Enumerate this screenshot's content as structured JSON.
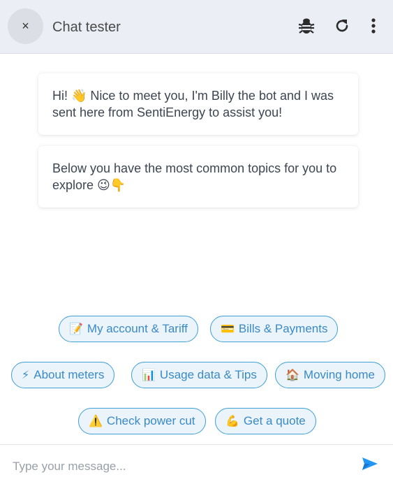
{
  "header": {
    "close_symbol": "×",
    "title": "Chat tester",
    "icons": [
      "close-icon",
      "bug-icon",
      "refresh-icon",
      "kebab-menu-icon"
    ]
  },
  "messages": [
    {
      "emoji": "👋",
      "text_before": "Hi! ",
      "text_after": " Nice to meet you, I'm Billy the bot and I was sent here from SentiEnergy to assist you!"
    },
    {
      "text": "Below you have the most common topics for you to explore ",
      "emoji": "😉👇"
    }
  ],
  "quick_replies": [
    {
      "emoji": "📝",
      "label": "My account & Tariff"
    },
    {
      "emoji": "💳",
      "label": "Bills & Payments"
    },
    {
      "emoji": "⚡",
      "label": "About meters"
    },
    {
      "emoji": "📊",
      "label": "Usage data & Tips"
    },
    {
      "emoji": "🏠",
      "label": "Moving home"
    },
    {
      "emoji": "⚠️",
      "label": "Check power cut"
    },
    {
      "emoji": "💪",
      "label": "Get a quote"
    }
  ],
  "composer": {
    "placeholder": "Type your message...",
    "send_icon": "send-icon"
  },
  "colors": {
    "header_bg": "#eceef5",
    "chip_border": "#3ea0d6",
    "chip_bg": "#ebf3fb",
    "chip_text": "#3a8ac4",
    "send": "#2196f3"
  }
}
